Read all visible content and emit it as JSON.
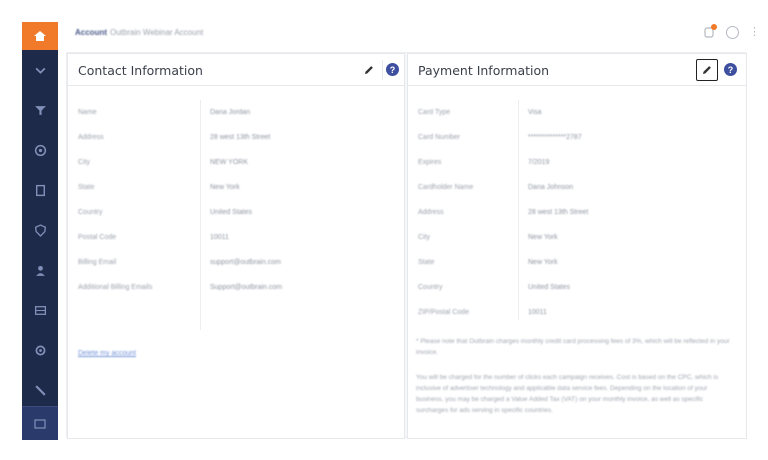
{
  "header": {
    "breadcrumb_bold": "Account",
    "breadcrumb_rest": "Outbrain Webinar Account"
  },
  "contact": {
    "title": "Contact Information",
    "rows": [
      {
        "label": "Name",
        "value": "Dana Jordan"
      },
      {
        "label": "Address",
        "value": "28 west 13th Street"
      },
      {
        "label": "City",
        "value": "NEW YORK"
      },
      {
        "label": "State",
        "value": "New York"
      },
      {
        "label": "Country",
        "value": "United States"
      },
      {
        "label": "Postal Code",
        "value": "10011"
      },
      {
        "label": "Billing Email",
        "value": "support@outbrain.com"
      },
      {
        "label": "Additional Billing Emails",
        "value": "Support@outbrain.com"
      }
    ],
    "delete_link": "Delete my account"
  },
  "payment": {
    "title": "Payment Information",
    "rows": [
      {
        "label": "Card Type",
        "value": "Visa"
      },
      {
        "label": "Card Number",
        "value": "**************2787"
      },
      {
        "label": "Expires",
        "value": "7/2019"
      },
      {
        "label": "Cardholder Name",
        "value": "Dana Johnson"
      },
      {
        "label": "Address",
        "value": "28 west 13th Street"
      },
      {
        "label": "City",
        "value": "New York"
      },
      {
        "label": "State",
        "value": "New York"
      },
      {
        "label": "Country",
        "value": "United States"
      },
      {
        "label": "ZIP/Postal Code",
        "value": "10011"
      }
    ],
    "note1": "* Please note that Outbrain charges monthly credit card processing fees of 3%, which will be reflected in your invoice.",
    "note2": "You will be charged for the number of clicks each campaign receives. Cost is based on the CPC, which is inclusive of advertiser technology and applicable data service fees. Depending on the location of your business, you may be charged a Value Added Tax (VAT) on your monthly invoice, as well as specific surcharges for ads serving in specific countries."
  },
  "colors": {
    "nav_bg": "#1e2a4a",
    "brand_orange": "#f07a2a",
    "help_blue": "#3e4fa0"
  }
}
